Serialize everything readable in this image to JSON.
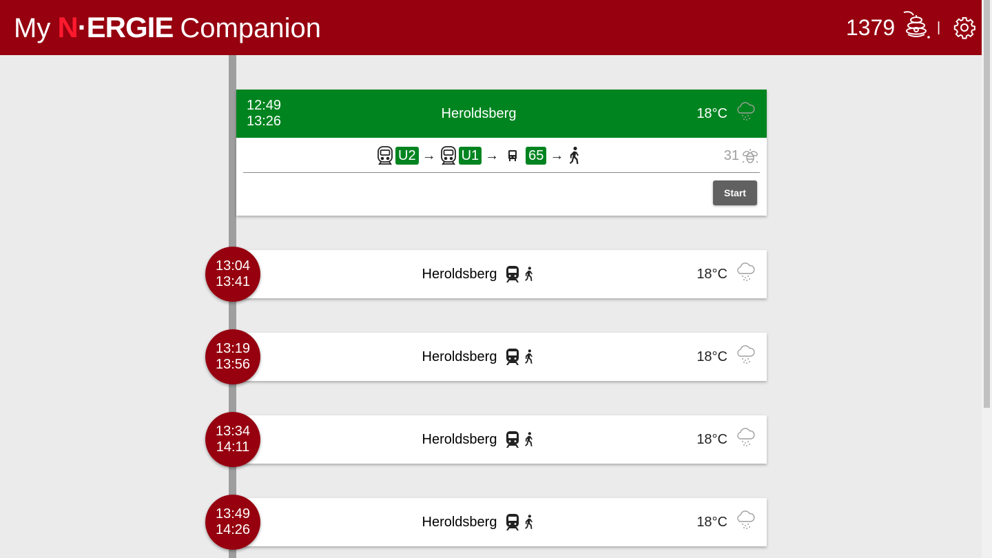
{
  "header": {
    "title_prefix": "My",
    "brand_n": "N",
    "brand_dot": "·",
    "brand_rest": "ERGIE",
    "title_suffix": "Companion",
    "points": "1379",
    "separator": "|",
    "icons": [
      "beehive-icon",
      "gear-icon"
    ]
  },
  "selected_trip": {
    "departure": "12:49",
    "arrival": "13:26",
    "destination": "Heroldsberg",
    "temperature": "18°C",
    "weather_icon": "cloud-snow-icon",
    "legs": [
      {
        "mode": "subway-icon",
        "line": "U2"
      },
      {
        "mode": "subway-icon",
        "line": "U1"
      },
      {
        "mode": "bus-icon",
        "line": "65"
      },
      {
        "mode": "walk-icon",
        "line": ""
      }
    ],
    "arrow": "→",
    "bee_points": "31",
    "bee_icon": "bee-icon",
    "start_label": "Start",
    "colors": {
      "accent_green": "#008420",
      "brand_red": "#96000f"
    }
  },
  "trips": [
    {
      "departure": "13:04",
      "arrival": "13:41",
      "destination": "Heroldsberg",
      "temperature": "18°C"
    },
    {
      "departure": "13:19",
      "arrival": "13:56",
      "destination": "Heroldsberg",
      "temperature": "18°C"
    },
    {
      "departure": "13:34",
      "arrival": "14:11",
      "destination": "Heroldsberg",
      "temperature": "18°C"
    },
    {
      "departure": "13:49",
      "arrival": "14:26",
      "destination": "Heroldsberg",
      "temperature": "18°C"
    }
  ]
}
